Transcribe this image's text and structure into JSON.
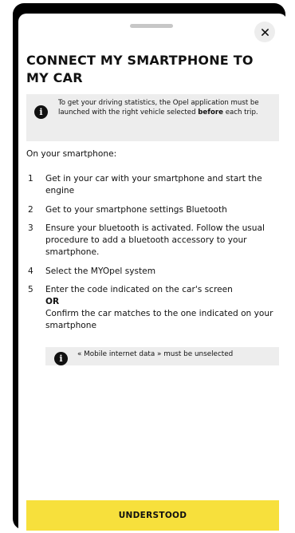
{
  "modal": {
    "title": "CONNECT MY SMARTPHONE TO MY CAR",
    "close_icon": "close-icon",
    "info_icon": "info-icon"
  },
  "info_banner": {
    "text_before": "To get your driving statistics, the Opel application must be launched with the right vehicle selected ",
    "text_bold": "before",
    "text_after": " each trip."
  },
  "intro": "On your smartphone:",
  "steps": [
    {
      "number": "1",
      "text": "Get in your car with your smartphone and start the engine"
    },
    {
      "number": "2",
      "text": "Get to your smartphone settings Bluetooth"
    },
    {
      "number": "3",
      "text": "Ensure your bluetooth is activated. Follow the usual procedure to add a bluetooth accessory to your smartphone."
    },
    {
      "number": "4",
      "text": "Select the MYOpel system"
    },
    {
      "number": "5",
      "text_before": "Enter the code indicated on the car's screen",
      "or_label": "OR",
      "text_after": "Confirm the car matches to the one indicated on your smartphone"
    }
  ],
  "note": "« Mobile internet data » must be unselected",
  "cta_label": "UNDERSTOOD",
  "colors": {
    "accent": "#f7e03c",
    "panel_gray": "#ededed",
    "frame": "#000000"
  }
}
